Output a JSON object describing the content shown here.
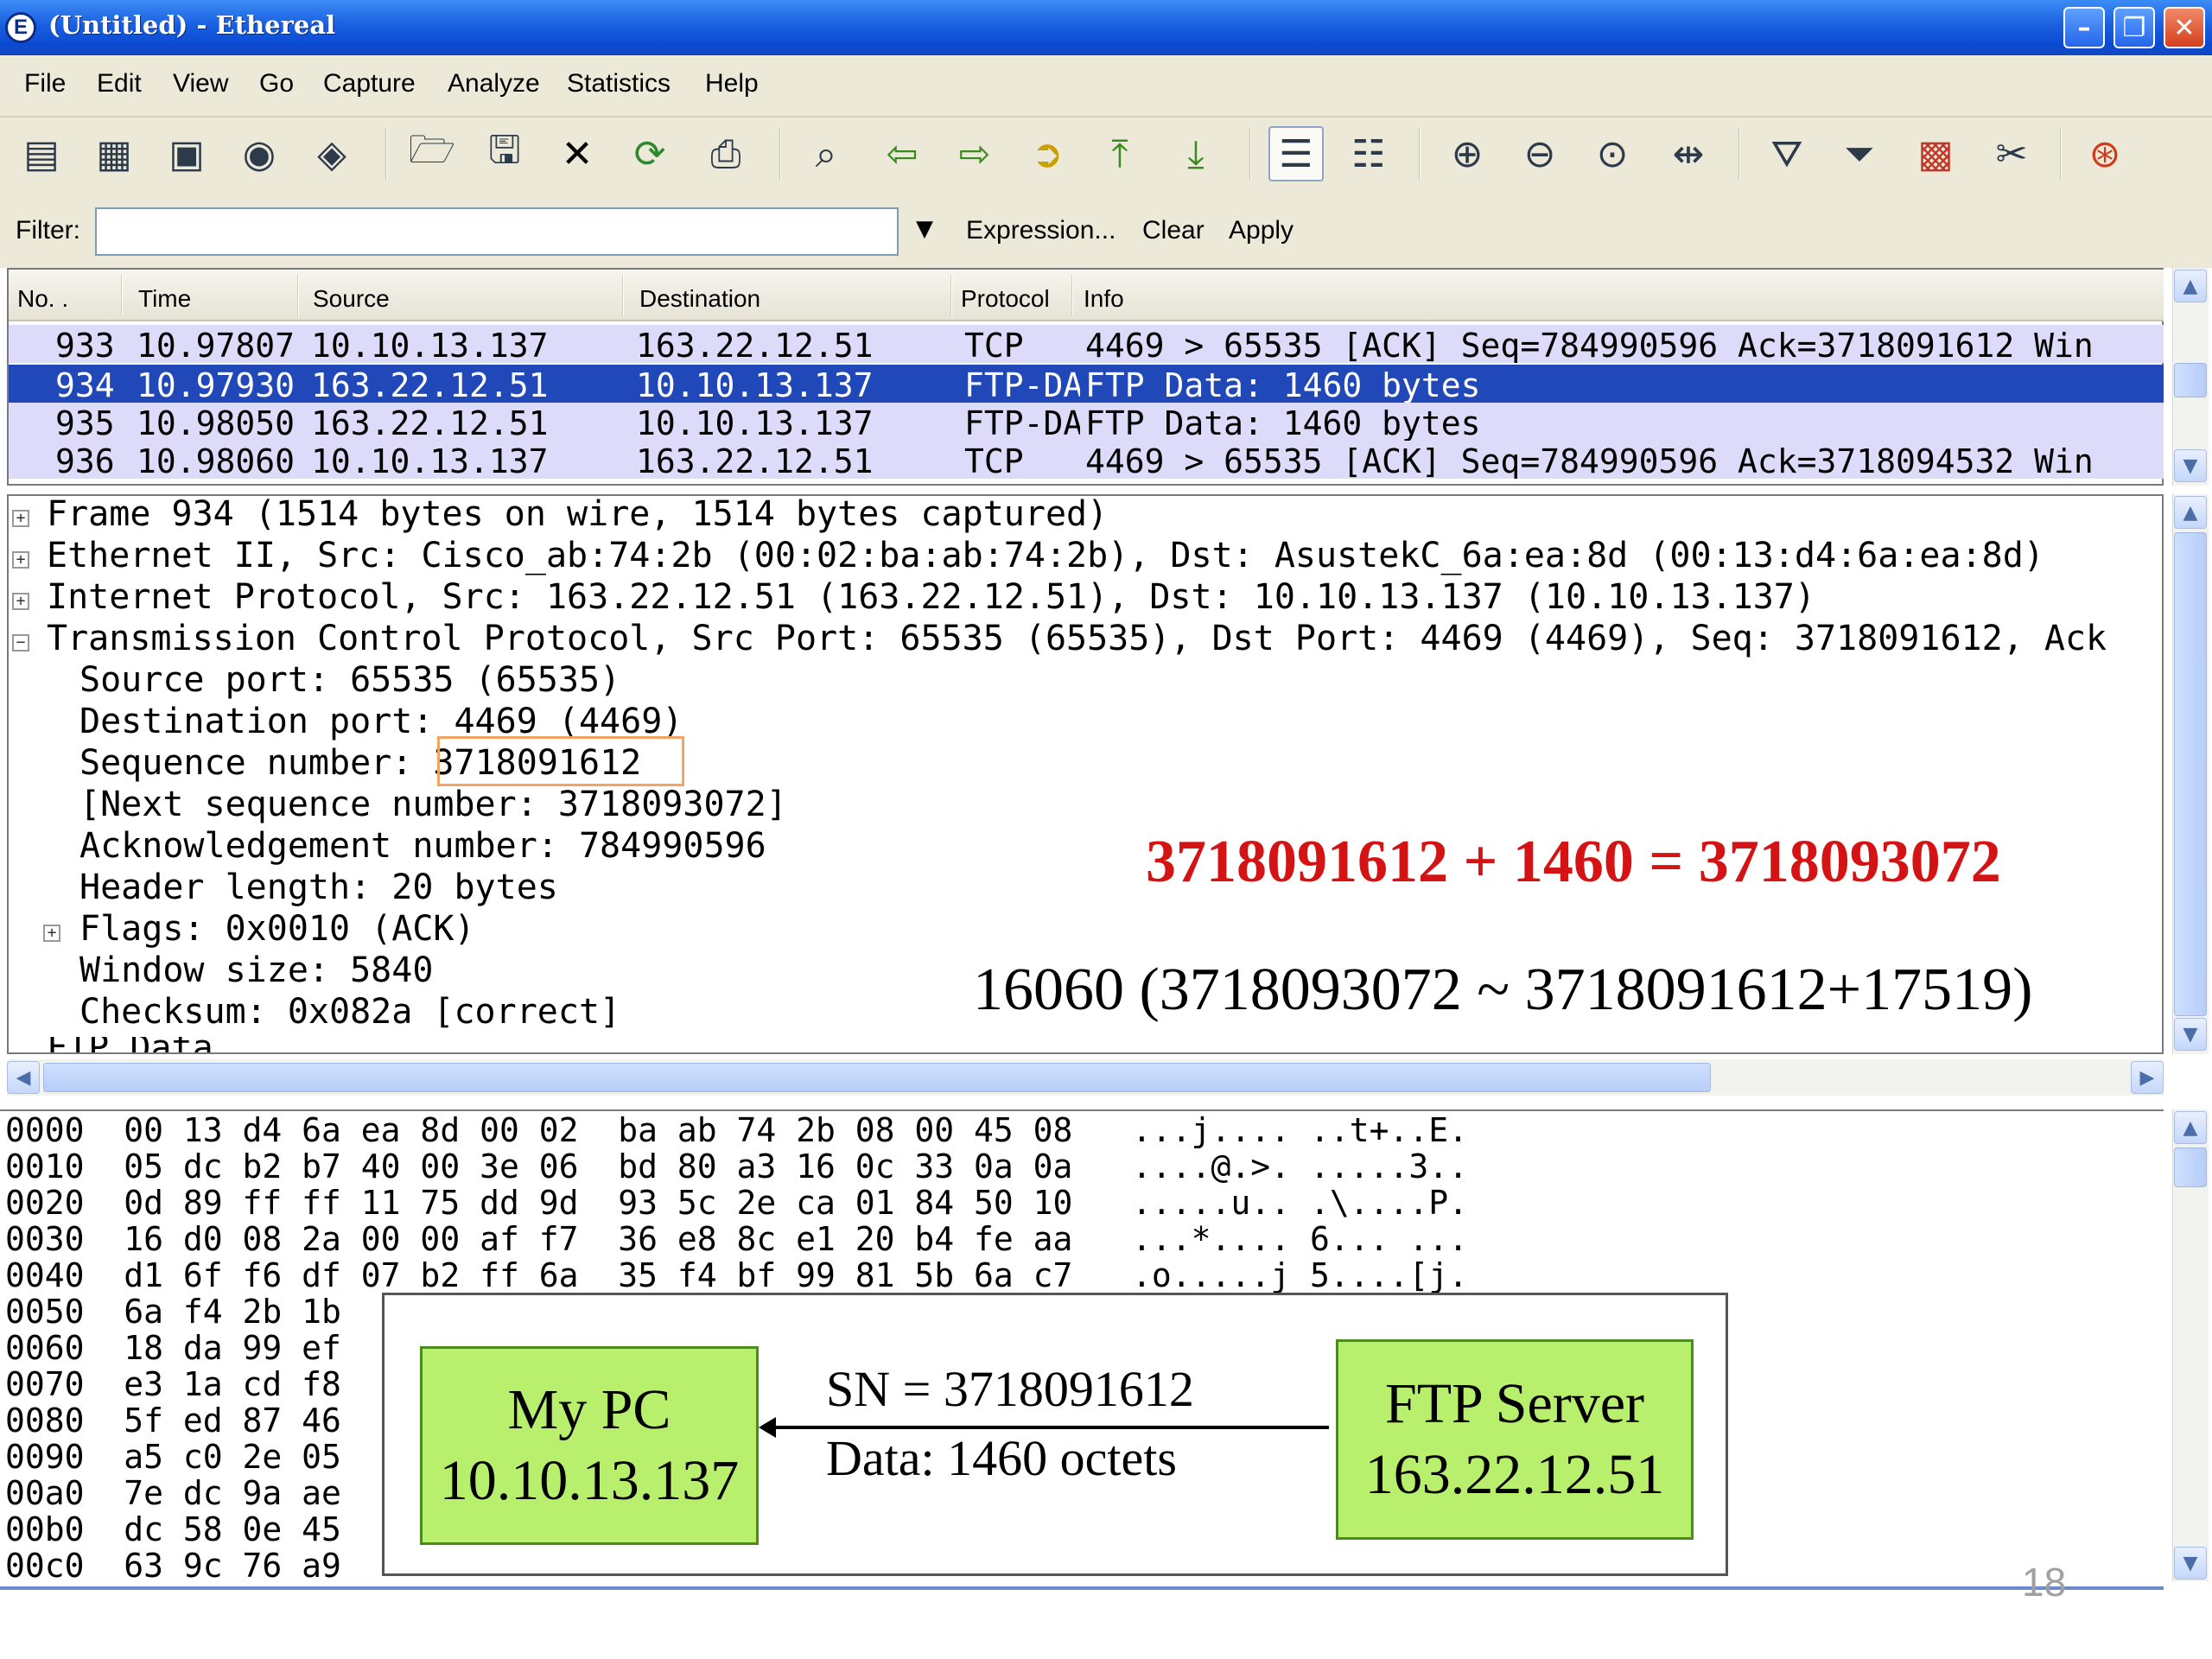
{
  "window": {
    "title": "(Untitled) - Ethereal",
    "app_icon": "E"
  },
  "menu": [
    "File",
    "Edit",
    "View",
    "Go",
    "Capture",
    "Analyze",
    "Statistics",
    "Help"
  ],
  "filter": {
    "label": "Filter:",
    "value": "",
    "expression": "Expression...",
    "clear": "Clear",
    "apply": "Apply"
  },
  "packet_list": {
    "columns": [
      "No. .",
      "Time",
      "Source",
      "Destination",
      "Protocol",
      "Info"
    ],
    "rows": [
      {
        "no": "933",
        "time": "10.97807",
        "src": "10.10.13.137",
        "dst": "163.22.12.51",
        "proto": "TCP",
        "info": "4469 > 65535 [ACK] Seq=784990596 Ack=3718091612 Win"
      },
      {
        "no": "934",
        "time": "10.97930",
        "src": "163.22.12.51",
        "dst": "10.10.13.137",
        "proto": "FTP-DATA",
        "info": "FTP Data: 1460 bytes"
      },
      {
        "no": "935",
        "time": "10.98050",
        "src": "163.22.12.51",
        "dst": "10.10.13.137",
        "proto": "FTP-DATA",
        "info": "FTP Data: 1460 bytes"
      },
      {
        "no": "936",
        "time": "10.98060",
        "src": "10.10.13.137",
        "dst": "163.22.12.51",
        "proto": "TCP",
        "info": "4469 > 65535 [ACK] Seq=784990596 Ack=3718094532 Win"
      }
    ]
  },
  "details": {
    "frame": "Frame 934 (1514 bytes on wire, 1514 bytes captured)",
    "ethernet": "Ethernet II, Src: Cisco_ab:74:2b (00:02:ba:ab:74:2b), Dst: AsustekC_6a:ea:8d (00:13:d4:6a:ea:8d)",
    "ip": "Internet Protocol, Src: 163.22.12.51 (163.22.12.51), Dst: 10.10.13.137 (10.10.13.137)",
    "tcp": "Transmission Control Protocol, Src Port: 65535 (65535), Dst Port: 4469 (4469), Seq: 3718091612, Ack",
    "src_port": "Source port: 65535 (65535)",
    "dst_port": "Destination port: 4469 (4469)",
    "seq_label": "Sequence number: ",
    "seq_value": "3718091612",
    "next_seq": "[Next sequence number: 3718093072]",
    "ack": "Acknowledgement number: 784990596",
    "header_len": "Header length: 20 bytes",
    "flags": "Flags: 0x0010 (ACK)",
    "window": "Window size: 5840",
    "checksum": "Checksum: 0x082a [correct]",
    "ftp_data": "FTP Data"
  },
  "annotations": {
    "equation": "3718091612 + 1460 = 3718093072",
    "range": "16060 (3718093072 ~ 3718091612+17519)"
  },
  "hex_lines": [
    "0000  00 13 d4 6a ea 8d 00 02  ba ab 74 2b 08 00 45 08   ...j.... ..t+..E.",
    "0010  05 dc b2 b7 40 00 3e 06  bd 80 a3 16 0c 33 0a 0a   ....@.>. .....3..",
    "0020  0d 89 ff ff 11 75 dd 9d  93 5c 2e ca 01 84 50 10   .....u.. .\\....P.",
    "0030  16 d0 08 2a 00 00 af f7  36 e8 8c e1 20 b4 fe aa   ...*.... 6... ...",
    "0040  d1 6f f6 df 07 b2 ff 6a  35 f4 bf 99 81 5b 6a c7   .o.....j 5....[j.",
    "0050  6a f4 2b 1b",
    "0060  18 da 99 ef",
    "0070  e3 1a cd f8",
    "0080  5f ed 87 46",
    "0090  a5 c0 2e 05",
    "00a0  7e dc 9a ae",
    "00b0  dc 58 0e 45",
    "00c0  63 9c 76 a9"
  ],
  "diagram": {
    "mypc_name": "My PC",
    "mypc_ip": "10.10.13.137",
    "server_name": "FTP Server",
    "server_ip": "163.22.12.51",
    "sn": "SN = 3718091612",
    "data": "Data: 1460 octets"
  },
  "slide_number": "18",
  "colors": {
    "title_bar": "#1a5fe0",
    "selected_row": "#2048b8",
    "alt_row": "#dcdcfa",
    "equation": "#d41414",
    "node_fill": "#b8f06e",
    "highlight_box": "#f4a460"
  },
  "icons": {
    "window_buttons": [
      "minimize-icon",
      "maximize-icon",
      "close-icon"
    ],
    "toolbar": [
      "interface-list-icon",
      "capture-options-icon",
      "start-capture-icon",
      "stop-capture-icon",
      "restart-capture-icon",
      "open-file-icon",
      "save-file-icon",
      "close-file-icon",
      "reload-icon",
      "print-icon",
      "find-packet-icon",
      "go-back-icon",
      "go-forward-icon",
      "go-to-packet-icon",
      "go-first-icon",
      "go-last-icon",
      "colorize-icon",
      "auto-scroll-icon",
      "zoom-in-icon",
      "zoom-out-icon",
      "zoom-normal-icon",
      "resize-columns-icon",
      "capture-filters-icon",
      "display-filters-icon",
      "coloring-rules-icon",
      "preferences-icon",
      "help-icon"
    ]
  }
}
